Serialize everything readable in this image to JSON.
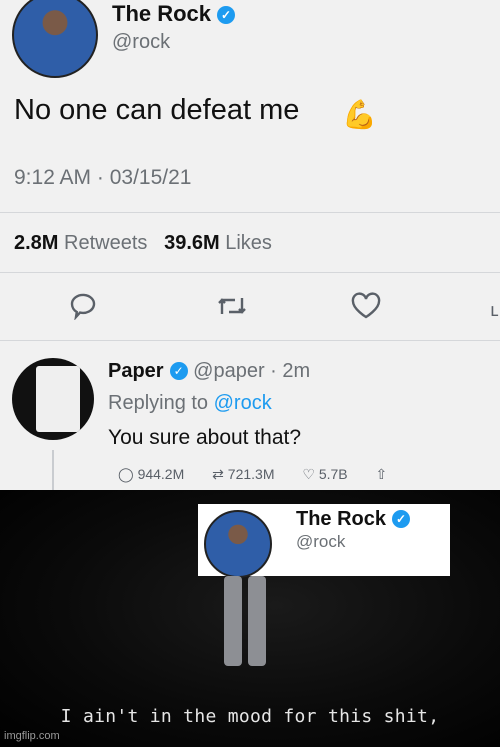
{
  "tweet": {
    "name": "The Rock",
    "handle": "@rock",
    "text": "No one can defeat me",
    "emoji": "💪",
    "timestamp": "9:12 AM · 03/15/21",
    "retweets_count": "2.8M",
    "retweets_label": "Retweets",
    "likes_count": "39.6M",
    "likes_label": "Likes"
  },
  "reply": {
    "name": "Paper",
    "handle": "@paper · 2m",
    "replying_prefix": "Replying to",
    "replying_mention": "@rock",
    "text": "You sure about that?",
    "replies": "944.2M",
    "retweets": "721.3M",
    "likes": "5.7B"
  },
  "meme": {
    "card_name": "The Rock",
    "card_handle": "@rock",
    "caption": "I ain't in the mood for this shit,",
    "watermark": "imgflip.com"
  },
  "icons": {
    "reply": "reply-icon",
    "retweet": "retweet-icon",
    "like": "heart-icon",
    "share": "share-icon",
    "verified": "verified-badge-icon"
  },
  "colors": {
    "accent": "#1d9bf0",
    "text": "#111111",
    "muted": "#6b7075"
  }
}
